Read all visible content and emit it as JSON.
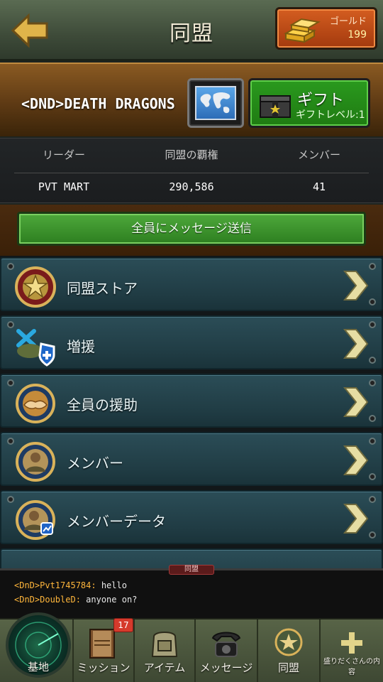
{
  "header": {
    "title": "同盟",
    "gold_label": "ゴールド",
    "gold_value": "199"
  },
  "alliance": {
    "name": "<DND>DEATH DRAGONS",
    "gift_title": "ギフト",
    "gift_subtitle": "ギフトレベル:1"
  },
  "stats": {
    "leader_label": "リーダー",
    "leader_value": "PVT MART",
    "power_label": "同盟の覇権",
    "power_value": "290,586",
    "members_label": "メンバー",
    "members_value": "41"
  },
  "message_button": "全員にメッセージ送信",
  "menu": [
    {
      "label": "同盟ストア",
      "icon": "star-medal-icon"
    },
    {
      "label": "増援",
      "icon": "reinforcement-shield-icon"
    },
    {
      "label": "全員の援助",
      "icon": "handshake-medal-icon"
    },
    {
      "label": "メンバー",
      "icon": "soldier-medal-icon"
    },
    {
      "label": "メンバーデータ",
      "icon": "soldier-data-medal-icon"
    }
  ],
  "chat": {
    "tab_label": "同盟",
    "messages": [
      {
        "sender": "<DnD>Pvt1745784:",
        "text": " hello"
      },
      {
        "sender": "<DnD>DoubleD:",
        "text": " anyone on?"
      }
    ]
  },
  "nav": {
    "base": "基地",
    "missions": "ミッション",
    "missions_badge": "17",
    "items": "アイテム",
    "messages": "メッセージ",
    "alliance": "同盟",
    "extra": "盛りだくさんの内容"
  },
  "colors": {
    "accent_green": "#2d7f20",
    "menu_teal": "#203c44",
    "gold_orange": "#d45d20",
    "banner_brown": "#5e3a14"
  }
}
